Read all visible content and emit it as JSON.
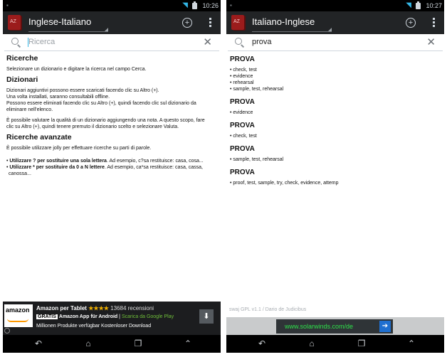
{
  "left": {
    "status": {
      "time": "10:26"
    },
    "app_title": "Inglese-Italiano",
    "search": {
      "value": "",
      "placeholder": "Ricerca"
    },
    "sections": [
      {
        "heading": "Ricerche",
        "paras": [
          [
            "Selezionare un dizionario e digitare la ricerca nel campo Cerca."
          ]
        ]
      },
      {
        "heading": "Dizionari",
        "paras": [
          [
            "Dizionari aggiuntivi possono essere scaricati facendo clic su Altro (+).",
            "Una volta installati, saranno consultabili offline.",
            "Possono essere eliminati facendo clic su Altro (+), quindi facendo clic sul dizionario da",
            "eliminare nell'elenco."
          ],
          [
            "È possibile valutare la qualità di un dizionario aggiungendo una nota. A questo scopo, fare",
            "clic su Altro (+), quindi tenere premuto il dizionario scelto e selezionare Valuta."
          ]
        ]
      },
      {
        "heading": "Ricerche avanzate",
        "paras": [
          [
            "È possibile utilizzare jolly per effettuare ricerche su parti di parole."
          ]
        ]
      }
    ],
    "wildcards": [
      {
        "bold": "Utilizzare ? per sostituire una sola lettera",
        "rest": ". Ad esempio, c?sa restituisce: casa, cosa..."
      },
      {
        "bold": "Utilizzare * per sostituire da 0 a N lettere",
        "rest": ". Ad esempio, ca*sa restituisce: casa, cassa,"
      },
      {
        "bold": "",
        "rest": "canossa..."
      }
    ],
    "ad": {
      "logo": "amazon",
      "title": "Amazon per Tablet",
      "stars": "★★★★",
      "reviews": "13684 recensioni",
      "badge": "GRATIS",
      "app": "Amazon App für Android",
      "separator": "|",
      "store": "Scarica da Google Play",
      "tagline": "Millionen Produkte verfügbar Kostenloser Download"
    }
  },
  "right": {
    "status": {
      "time": "10:27"
    },
    "app_title": "Italiano-Inglese",
    "search": {
      "value": "prova",
      "placeholder": ""
    },
    "results": [
      {
        "word": "PROVA",
        "defs": [
          "• check, test",
          "• evidence",
          "• rehearsal",
          "• sample, test, rehearsal"
        ]
      },
      {
        "word": "PROVA",
        "defs": [
          "• evidence"
        ]
      },
      {
        "word": "PROVA",
        "defs": [
          "• check, test"
        ]
      },
      {
        "word": "PROVA",
        "defs": [
          "• sample, test, rehearsal"
        ]
      },
      {
        "word": "PROVA",
        "defs": [
          "• proof, test, sample, try, check, evidence, attemp"
        ]
      }
    ],
    "credit": "swaj GPL v1.1 / Dario de Judicibus",
    "ad": {
      "url": "www.solarwinds.com/de"
    }
  },
  "icons": {
    "search": "magnifier-icon",
    "clear": "close-icon",
    "add": "add-circle-icon",
    "menu": "overflow-menu-icon",
    "back": "back-icon",
    "home": "home-icon",
    "recent": "recent-apps-icon",
    "up": "chevron-up-icon"
  },
  "colors": {
    "status_bar": "#000000",
    "action_bar": "#222426",
    "accent": "#33b5e5",
    "ad_url": "#2fe14a"
  }
}
